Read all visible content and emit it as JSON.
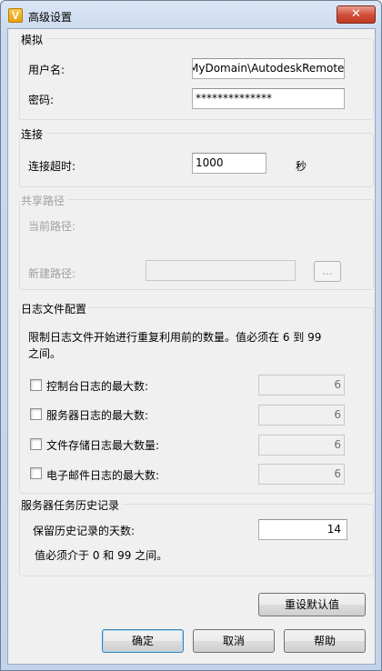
{
  "window": {
    "title": "高级设置",
    "close_glyph": "✕"
  },
  "simulation": {
    "title": "模拟",
    "username_label": "用户名:",
    "username_value": "MyDomain\\AutodeskRemote",
    "password_label": "密码:",
    "password_value": "**************"
  },
  "connection": {
    "title": "连接",
    "timeout_label": "连接超时:",
    "timeout_value": "1000",
    "unit": "秒"
  },
  "shared_path": {
    "title": "共享路径",
    "current_label": "当前路径:",
    "new_label": "新建路径:",
    "browse_label": "..."
  },
  "log_config": {
    "title": "日志文件配置",
    "description": "限制日志文件开始进行重复利用前的数量。值必须在 6 到 99 之间。",
    "items": [
      {
        "label": "控制台日志的最大数:",
        "checked": false,
        "value": "6"
      },
      {
        "label": "服务器日志的最大数:",
        "checked": false,
        "value": "6"
      },
      {
        "label": "文件存储日志最大数量:",
        "checked": false,
        "value": "6"
      },
      {
        "label": "电子邮件日志的最大数:",
        "checked": false,
        "value": "6"
      }
    ]
  },
  "history": {
    "title": "服务器任务历史记录",
    "days_label": "保留历史记录的天数:",
    "days_value": "14",
    "hint": "值必须介于 0 和 99 之间。"
  },
  "buttons": {
    "reset": "重设默认值",
    "ok": "确定",
    "cancel": "取消",
    "help": "帮助"
  }
}
